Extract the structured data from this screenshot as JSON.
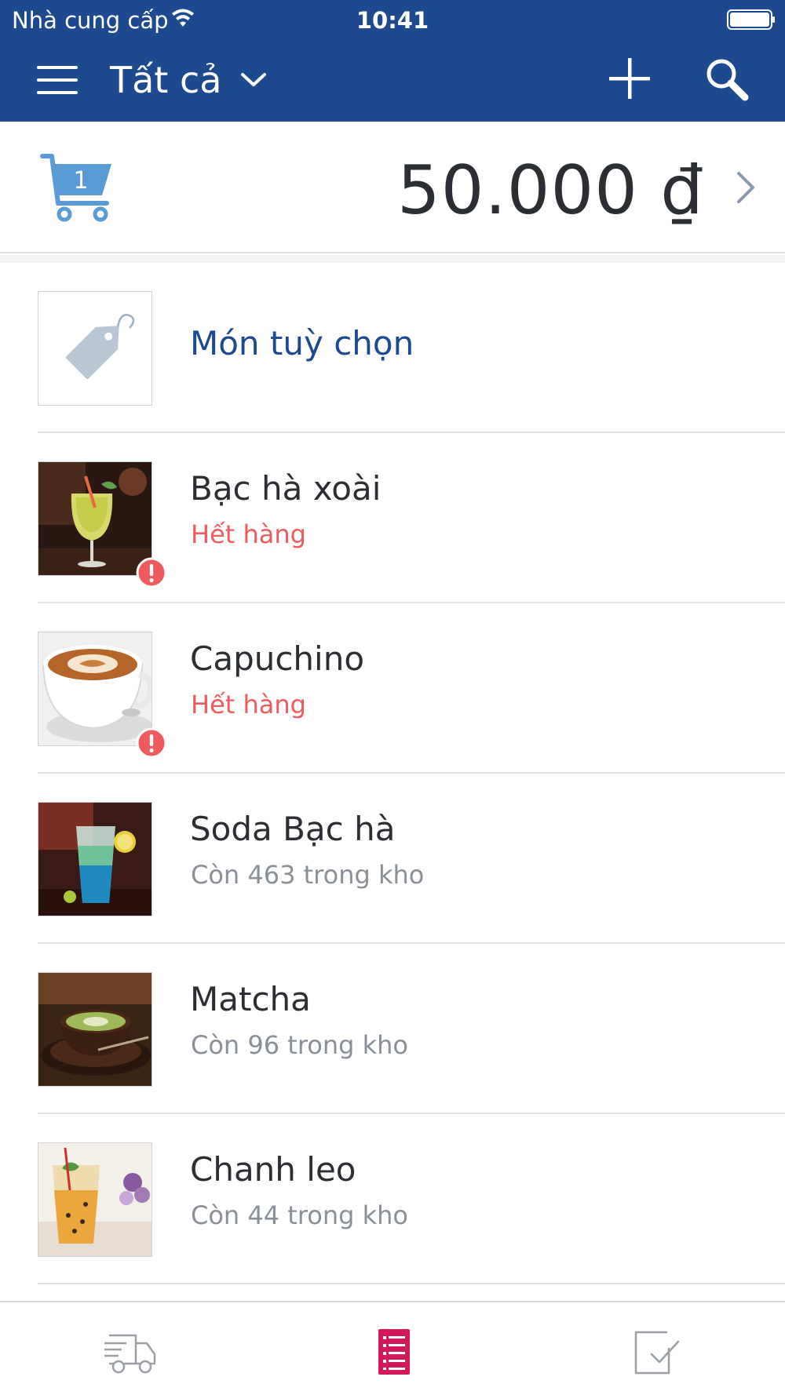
{
  "status_bar": {
    "carrier": "Nhà cung cấp",
    "time": "10:41"
  },
  "nav": {
    "filter_label": "Tất cả",
    "icons": [
      "menu-icon",
      "chevron-down-icon",
      "add-icon",
      "search-icon"
    ]
  },
  "cart": {
    "count": "1",
    "total": "50.000 ₫"
  },
  "products": [
    {
      "name": "Món tuỳ chọn",
      "stock": "",
      "type": "custom",
      "thumb": "tag-icon"
    },
    {
      "name": "Bạc hà xoài",
      "stock": "Hết hàng",
      "out_of_stock": true,
      "thumb": "mango-mint-drink"
    },
    {
      "name": "Capuchino",
      "stock": "Hết hàng",
      "out_of_stock": true,
      "thumb": "cappuccino-cup"
    },
    {
      "name": "Soda Bạc hà",
      "stock": "Còn 463 trong kho",
      "out_of_stock": false,
      "thumb": "mint-soda"
    },
    {
      "name": "Matcha",
      "stock": "Còn 96 trong kho",
      "out_of_stock": false,
      "thumb": "matcha-latte"
    },
    {
      "name": "Chanh leo",
      "stock": "Còn 44 trong kho",
      "out_of_stock": false,
      "thumb": "passion-fruit-drink"
    }
  ],
  "tab_bar": {
    "tabs": [
      {
        "icon": "delivery-truck-icon",
        "active": false
      },
      {
        "icon": "list-icon",
        "active": true
      },
      {
        "icon": "checklist-icon",
        "active": false
      }
    ]
  },
  "colors": {
    "header": "#1d4a8f",
    "accent_text": "#1d4a8f",
    "out_of_stock": "#ef5a5f",
    "active_tab": "#d1195c",
    "inactive_tab": "#9aa0a6",
    "cart_blue": "#5b9bd5"
  }
}
